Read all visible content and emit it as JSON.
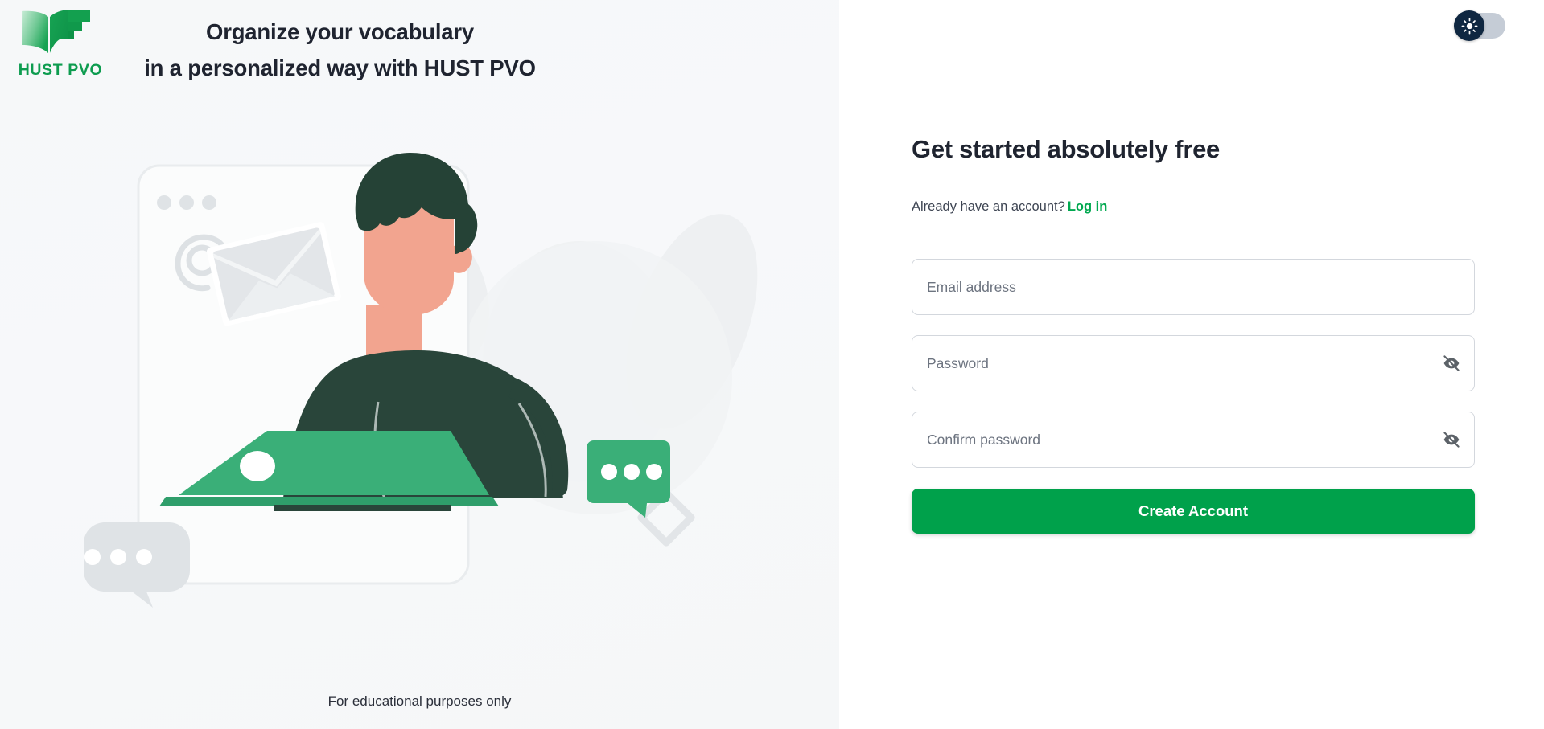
{
  "brand": {
    "logo_icon": "open-book-icon",
    "logo_text": "HUST PVO"
  },
  "left": {
    "headline_line1": "Organize your vocabulary",
    "headline_line2": "in a personalized way with HUST PVO",
    "footnote": "For educational purposes only",
    "illustration": {
      "name": "person-at-laptop-illustration",
      "elements": [
        "browser-window-frame",
        "window-dot-1",
        "window-dot-2",
        "window-dot-3",
        "at-symbol-icon",
        "envelope-icon",
        "person-figure",
        "green-laptop",
        "gray-chat-bubble",
        "green-chat-bubble",
        "diamond-outline-icon",
        "leaf-decorations"
      ],
      "colors": {
        "sweater": "#29453a",
        "hair": "#254236",
        "skin": "#f2a48f",
        "laptop": "#3aaf78",
        "chat_bubble_green": "#3aaf78",
        "chat_bubble_gray": "#dfe3e6",
        "envelope": "#e2e5e8",
        "background": "#f5f7f8"
      }
    }
  },
  "right": {
    "theme_toggle": {
      "icon": "sun-icon",
      "state": "light",
      "knob_color": "#0f2741",
      "track_color": "#c5ccd6"
    },
    "title": "Get started absolutely free",
    "already_text": "Already have an account?",
    "login_label": "Log in",
    "fields": [
      {
        "name": "email",
        "placeholder": "Email address",
        "value": "",
        "type": "email",
        "has_toggle": false
      },
      {
        "name": "password",
        "placeholder": "Password",
        "value": "",
        "type": "password",
        "has_toggle": true,
        "toggle_icon": "eye-off-icon"
      },
      {
        "name": "confirm_password",
        "placeholder": "Confirm password",
        "value": "",
        "type": "password",
        "has_toggle": true,
        "toggle_icon": "eye-off-icon"
      }
    ],
    "submit_label": "Create Account"
  },
  "colors": {
    "accent_green": "#00a14b",
    "link_green": "#00a84f",
    "logo_green": "#0d9c4f",
    "text_dark": "#1f2430",
    "panel_bg": "#f5f7f8"
  }
}
